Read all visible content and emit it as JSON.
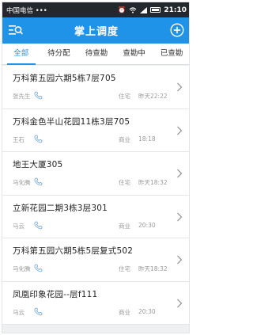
{
  "status": {
    "carrier": "中国电信 •••",
    "time": "21:10",
    "icons": [
      "alarm-icon",
      "wifi-icon",
      "signal-icon",
      "battery-icon"
    ]
  },
  "header": {
    "title": "掌上调度",
    "menu_icon": "menu-search-icon",
    "add_icon": "plus-circle-icon"
  },
  "tabs": [
    {
      "label": "全部",
      "active": true
    },
    {
      "label": "待分配",
      "active": false
    },
    {
      "label": "待查勘",
      "active": false
    },
    {
      "label": "查勘中",
      "active": false
    },
    {
      "label": "已查勘",
      "active": false
    }
  ],
  "items": [
    {
      "address": "万科第五园六期5栋7层705",
      "name": "张先生",
      "type": "住宅",
      "time": "昨天22:22"
    },
    {
      "address": "万科金色半山花园11栋3层705",
      "name": "王石",
      "type": "商业",
      "time": "18:18"
    },
    {
      "address": "地王大厦305",
      "name": "马化腾",
      "type": "住宅",
      "time": "昨天18:32"
    },
    {
      "address": "立新花园二期3栋3层301",
      "name": "马云",
      "type": "商业",
      "time": "20:30"
    },
    {
      "address": "万科第五园六期5栋5层复式502",
      "name": "马化腾",
      "type": "住宅",
      "time": "昨天18:32"
    },
    {
      "address": "凤凰印象花园--层f111",
      "name": "马云",
      "type": "商业",
      "time": "20:30"
    }
  ],
  "colors": {
    "primary": "#1e93e8",
    "statusbar": "#24272b",
    "phone_icon": "#6aa3d6"
  }
}
